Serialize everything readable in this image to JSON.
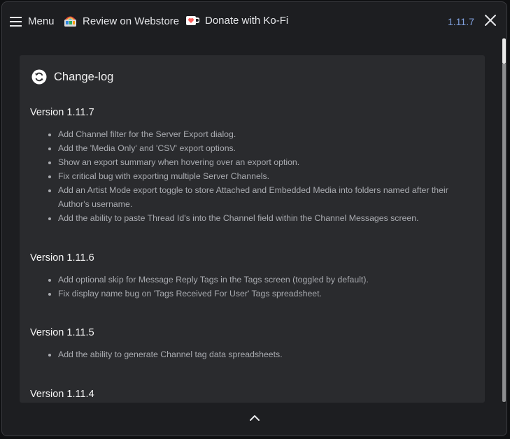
{
  "header": {
    "menu_label": "Menu",
    "review_label": "Review on Webstore",
    "donate_label": "Donate with Ko-Fi",
    "version": "1.11.7"
  },
  "changelog": {
    "title": "Change-log",
    "sections": [
      {
        "version": "Version 1.11.7",
        "items": [
          "Add Channel filter for the Server Export dialog.",
          "Add the 'Media Only' and 'CSV' export options.",
          "Show an export summary when hovering over an export option.",
          "Fix critical bug with exporting multiple Server Channels.",
          "Add an Artist Mode export toggle to store Attached and Embedded Media into folders named after their Author's username.",
          "Add the ability to paste Thread Id's into the Channel field within the Channel Messages screen."
        ]
      },
      {
        "version": "Version 1.11.6",
        "items": [
          "Add optional skip for Message Reply Tags in the Tags screen (toggled by default).",
          "Fix display name bug on 'Tags Received For User' Tags spreadsheet."
        ]
      },
      {
        "version": "Version 1.11.5",
        "items": [
          "Add the ability to generate Channel tag data spreadsheets."
        ]
      },
      {
        "version": "Version 1.11.4",
        "items": []
      }
    ]
  },
  "icons": {
    "menu": "hamburger-icon",
    "review": "rainbow-store-icon",
    "donate": "kofi-cup-icon",
    "close": "close-icon",
    "changelog": "sync-icon",
    "footer": "chevron-up-icon"
  },
  "colors": {
    "accent": "#7f9fdc",
    "background": "#1d1e21",
    "card": "#2a2b2e"
  }
}
